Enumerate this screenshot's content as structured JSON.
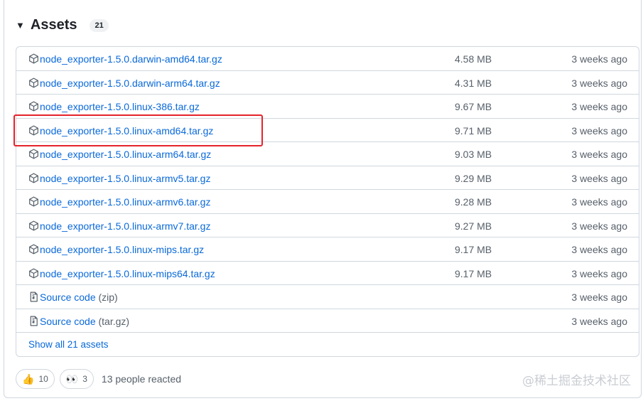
{
  "assets": {
    "title": "Assets",
    "count": "21",
    "items": [
      {
        "name": "node_exporter-1.5.0.darwin-amd64.tar.gz",
        "suffix": "",
        "size": "4.58 MB",
        "date": "3 weeks ago",
        "icon": "package-icon"
      },
      {
        "name": "node_exporter-1.5.0.darwin-arm64.tar.gz",
        "suffix": "",
        "size": "4.31 MB",
        "date": "3 weeks ago",
        "icon": "package-icon"
      },
      {
        "name": "node_exporter-1.5.0.linux-386.tar.gz",
        "suffix": "",
        "size": "9.67 MB",
        "date": "3 weeks ago",
        "icon": "package-icon"
      },
      {
        "name": "node_exporter-1.5.0.linux-amd64.tar.gz",
        "suffix": "",
        "size": "9.71 MB",
        "date": "3 weeks ago",
        "icon": "package-icon"
      },
      {
        "name": "node_exporter-1.5.0.linux-arm64.tar.gz",
        "suffix": "",
        "size": "9.03 MB",
        "date": "3 weeks ago",
        "icon": "package-icon"
      },
      {
        "name": "node_exporter-1.5.0.linux-armv5.tar.gz",
        "suffix": "",
        "size": "9.29 MB",
        "date": "3 weeks ago",
        "icon": "package-icon"
      },
      {
        "name": "node_exporter-1.5.0.linux-armv6.tar.gz",
        "suffix": "",
        "size": "9.28 MB",
        "date": "3 weeks ago",
        "icon": "package-icon"
      },
      {
        "name": "node_exporter-1.5.0.linux-armv7.tar.gz",
        "suffix": "",
        "size": "9.27 MB",
        "date": "3 weeks ago",
        "icon": "package-icon"
      },
      {
        "name": "node_exporter-1.5.0.linux-mips.tar.gz",
        "suffix": "",
        "size": "9.17 MB",
        "date": "3 weeks ago",
        "icon": "package-icon"
      },
      {
        "name": "node_exporter-1.5.0.linux-mips64.tar.gz",
        "suffix": "",
        "size": "9.17 MB",
        "date": "3 weeks ago",
        "icon": "package-icon"
      },
      {
        "name": "Source code",
        "suffix": "(zip)",
        "size": "",
        "date": "3 weeks ago",
        "icon": "file-zip-icon"
      },
      {
        "name": "Source code",
        "suffix": "(tar.gz)",
        "size": "",
        "date": "3 weeks ago",
        "icon": "file-zip-icon"
      }
    ],
    "show_all": "Show all 21 assets"
  },
  "reactions": {
    "thumbs_up": {
      "emoji": "👍",
      "count": "10"
    },
    "eyes": {
      "emoji": "👀",
      "count": "3"
    },
    "summary": "13 people reacted"
  },
  "watermark": "@稀土掘金技术社区",
  "colors": {
    "link": "#0969da",
    "muted": "#57606a",
    "border": "#d0d7de",
    "highlight": "#e5232b"
  }
}
